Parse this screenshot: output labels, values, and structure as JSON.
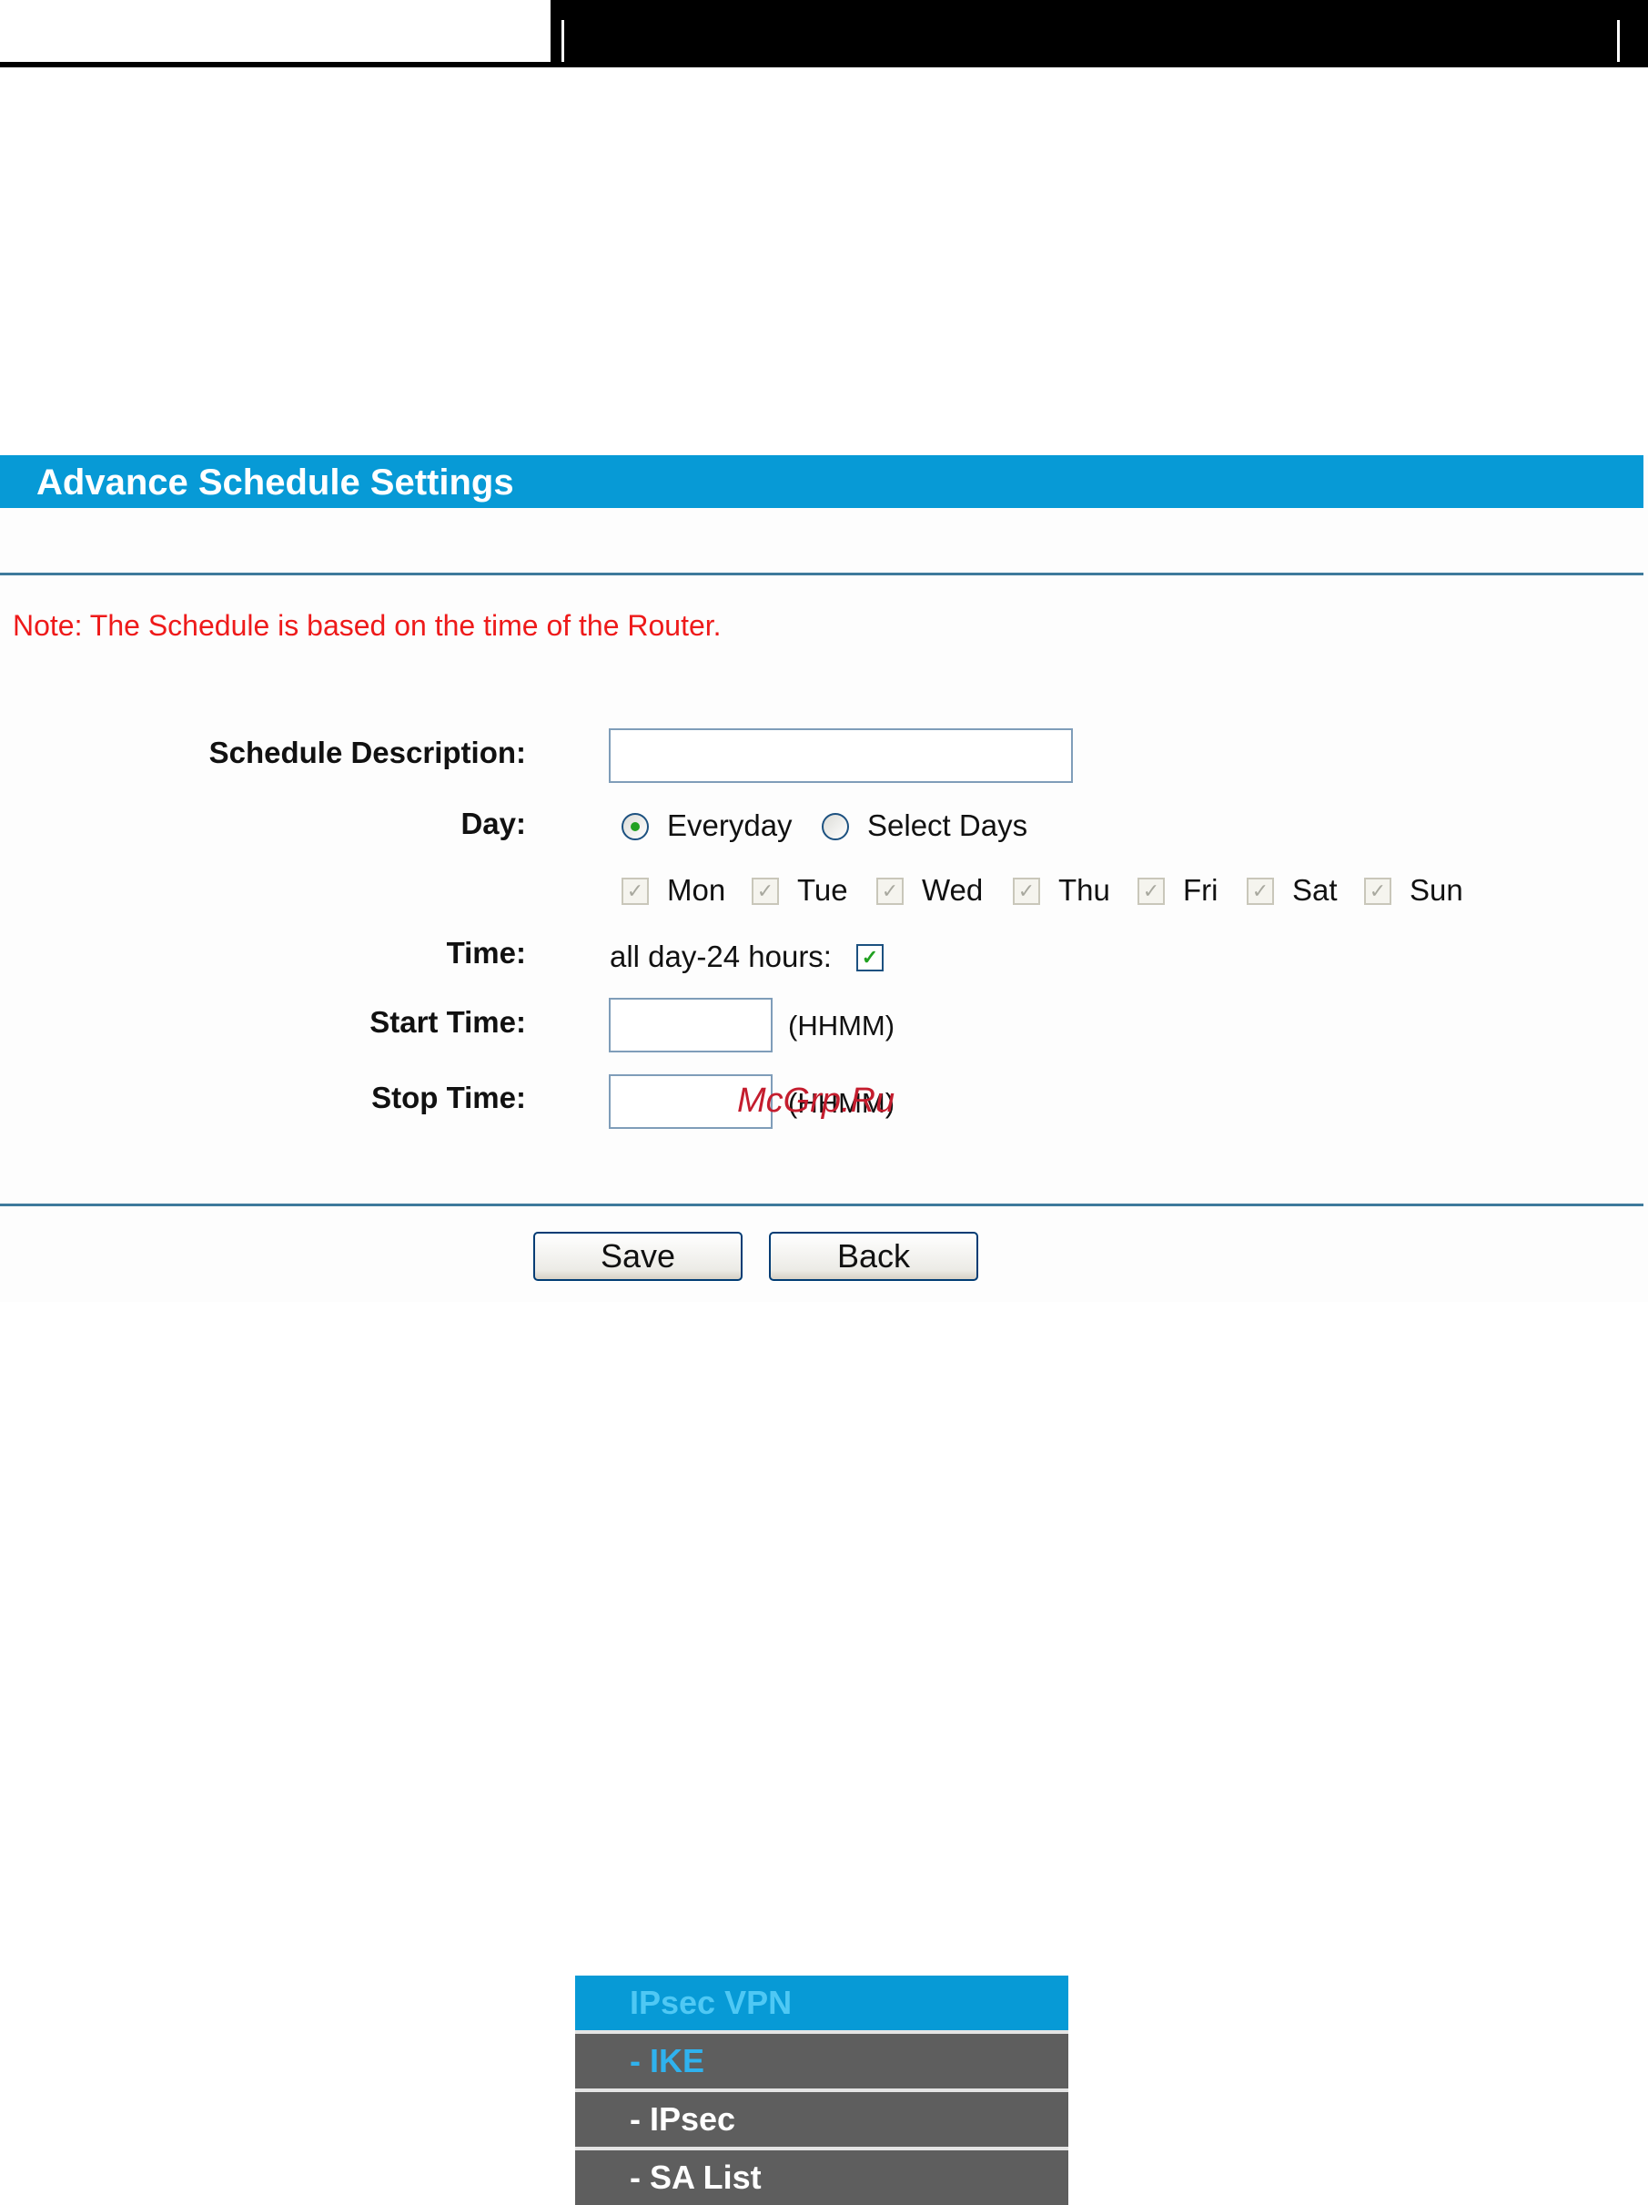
{
  "panel": {
    "title": "Advance Schedule Settings",
    "note": "Note: The Schedule is based on the time of the Router."
  },
  "form": {
    "description_label": "Schedule Description:",
    "description_value": "",
    "day_label": "Day:",
    "day_options": [
      {
        "label": "Everyday",
        "selected": true
      },
      {
        "label": "Select Days",
        "selected": false
      }
    ],
    "days": [
      "Mon",
      "Tue",
      "Wed",
      "Thu",
      "Fri",
      "Sat",
      "Sun"
    ],
    "time_label": "Time:",
    "all_day_label": "all day-24 hours:",
    "all_day_checked": true,
    "start_label": "Start Time:",
    "start_value": "",
    "stop_label": "Stop Time:",
    "stop_value": "",
    "format_hint": "(HHMM)"
  },
  "buttons": {
    "save": "Save",
    "back": "Back"
  },
  "watermark": "McGrp.Ru",
  "menu": {
    "header": "IPsec VPN",
    "items": [
      {
        "label": "- IKE",
        "active": true
      },
      {
        "label": "- IPsec",
        "active": false
      },
      {
        "label": "- SA List",
        "active": false
      }
    ]
  },
  "colors": {
    "accent": "#079ad6",
    "note_red": "#ee1a1a",
    "menu_grey": "#5e5e5e"
  }
}
